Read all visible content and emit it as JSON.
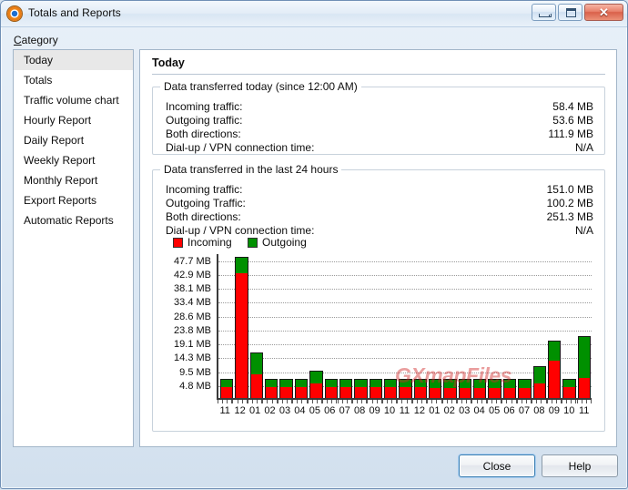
{
  "window": {
    "title": "Totals and Reports",
    "icon": "app-target-icon",
    "controls": {
      "minimize": "minimize-button",
      "maximize": "maximize-button",
      "close": "close-button",
      "close_glyph": "✕"
    }
  },
  "sidebar": {
    "label": "Category",
    "label_accesskey": "C",
    "selected": "Today",
    "items": [
      {
        "label": "Today"
      },
      {
        "label": "Totals"
      },
      {
        "label": "Traffic volume chart"
      },
      {
        "label": "Hourly Report"
      },
      {
        "label": "Daily Report"
      },
      {
        "label": "Weekly Report"
      },
      {
        "label": "Monthly Report"
      },
      {
        "label": "Export Reports"
      },
      {
        "label": "Automatic Reports"
      }
    ]
  },
  "main": {
    "title": "Today",
    "today_group": {
      "title": "Data transferred today (since 12:00 AM)",
      "rows": [
        {
          "label": "Incoming traffic:",
          "value": "58.4 MB"
        },
        {
          "label": "Outgoing traffic:",
          "value": "53.6 MB"
        },
        {
          "label": "Both directions:",
          "value": "111.9 MB"
        },
        {
          "label": "Dial-up / VPN connection time:",
          "value": "N/A"
        }
      ]
    },
    "last24_group": {
      "title": "Data transferred in the last 24 hours",
      "rows": [
        {
          "label": "Incoming traffic:",
          "value": "151.0 MB"
        },
        {
          "label": "Outgoing Traffic:",
          "value": "100.2 MB"
        },
        {
          "label": "Both directions:",
          "value": "251.3 MB"
        },
        {
          "label": "Dial-up / VPN connection time:",
          "value": "N/A"
        }
      ]
    },
    "watermark": "GXmapFiles"
  },
  "footer": {
    "close_label": "Close",
    "help_label": "Help"
  },
  "colors": {
    "incoming": "#ff0000",
    "outgoing": "#009000",
    "window_border": "#6f8fb5",
    "panel_bg": "#ffffff",
    "selection": "#e8e8e8"
  },
  "chart_data": {
    "type": "bar",
    "stacked": true,
    "title": "",
    "xlabel": "",
    "ylabel": "",
    "unit": "MB",
    "grid": true,
    "legend_position": "above-chart",
    "ylim": [
      0,
      50.1
    ],
    "ytick_labels": [
      "47.7 MB",
      "42.9 MB",
      "38.1 MB",
      "33.4 MB",
      "28.6 MB",
      "23.8 MB",
      "19.1 MB",
      "14.3 MB",
      "9.5 MB",
      "4.8 MB"
    ],
    "ytick_values": [
      47.7,
      42.9,
      38.1,
      33.4,
      28.6,
      23.8,
      19.1,
      14.3,
      9.5,
      4.8
    ],
    "categories": [
      "11",
      "12",
      "01",
      "02",
      "03",
      "04",
      "05",
      "06",
      "07",
      "08",
      "09",
      "10",
      "11",
      "12",
      "01",
      "02",
      "03",
      "04",
      "05",
      "06",
      "07",
      "08",
      "09",
      "10",
      "11"
    ],
    "legend": [
      "Incoming",
      "Outgoing"
    ],
    "series": [
      {
        "name": "Incoming",
        "color": "#ff0000",
        "values": [
          3.8,
          42.9,
          8.3,
          3.8,
          3.8,
          3.8,
          5.1,
          3.8,
          3.8,
          3.8,
          3.8,
          3.8,
          3.8,
          3.8,
          3.6,
          3.6,
          3.6,
          3.6,
          3.6,
          3.6,
          3.6,
          5.0,
          12.7,
          3.8,
          6.8
        ]
      },
      {
        "name": "Outgoing",
        "color": "#009000",
        "values": [
          2.8,
          5.6,
          7.3,
          2.8,
          2.8,
          2.8,
          4.4,
          2.8,
          2.8,
          2.8,
          2.8,
          2.8,
          2.8,
          2.8,
          3.0,
          3.0,
          3.0,
          3.0,
          3.0,
          3.0,
          3.0,
          5.9,
          7.1,
          2.8,
          14.5
        ]
      }
    ]
  }
}
